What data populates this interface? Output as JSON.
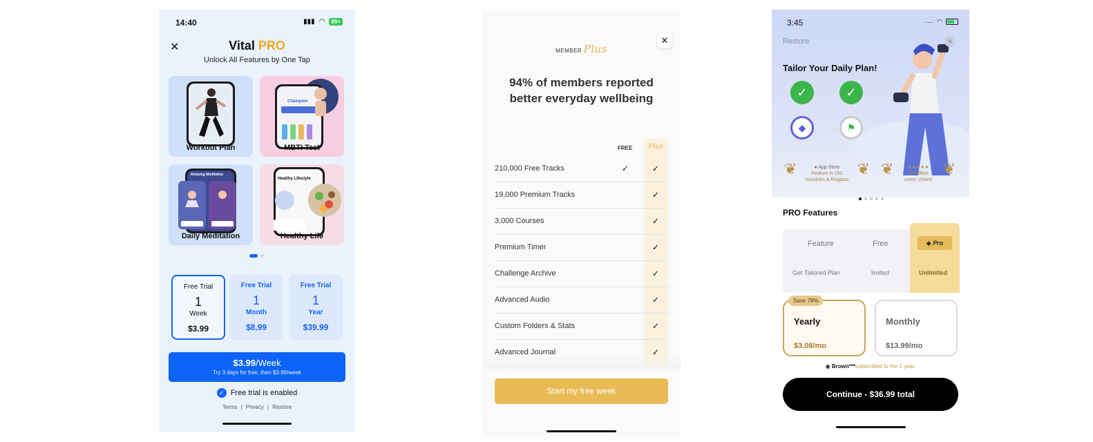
{
  "screen1": {
    "status_time": "14:40",
    "battery": "89+",
    "title_main": "Vital",
    "title_pro": "PRO",
    "subtitle": "Unlock All Features by One Tap",
    "cards": [
      {
        "label": "Workout Plan"
      },
      {
        "label": "MBTI Test"
      },
      {
        "label": "Daily Meditation"
      },
      {
        "label": "Healthy Life"
      }
    ],
    "card_texts": {
      "champion": "Champion",
      "relaxing_meditation": "Relaxing Meditation",
      "healthy_lifestyle": "Healthy Lifestyle"
    },
    "plans": [
      {
        "title": "Free Trial",
        "number": "1",
        "unit": "Week",
        "price": "$3.99",
        "selected": true
      },
      {
        "title": "Free Trial",
        "number": "1",
        "unit": "Month",
        "price": "$8.99",
        "selected": false
      },
      {
        "title": "Free Trial",
        "number": "1",
        "unit": "Year",
        "price": "$39.99",
        "selected": false
      }
    ],
    "cta_price": "$3.99",
    "cta_unit": "/Week",
    "cta_sub": "Try 3 days for free, then $3.99/week",
    "trial_enabled": "Free trial is enabled",
    "links": [
      "Terms",
      "Privacy",
      "Restore"
    ],
    "separator": "|"
  },
  "screen2": {
    "logo_member": "MEMBER",
    "logo_plus": "Plus",
    "headline": "94% of members reported better everyday wellbeing",
    "col_free": "FREE",
    "col_plus": "Plus",
    "check": "✓",
    "features": [
      {
        "name": "210,000 Free Tracks",
        "free": true
      },
      {
        "name": "19,000 Premium Tracks",
        "free": false
      },
      {
        "name": "3,000 Courses",
        "free": false
      },
      {
        "name": "Premium Timer",
        "free": false
      },
      {
        "name": "Challenge Archive",
        "free": false
      },
      {
        "name": "Advanced Audio",
        "free": false
      },
      {
        "name": "Custom Folders & Stats",
        "free": false
      },
      {
        "name": "Advanced Journal",
        "free": false
      }
    ],
    "cta": "Start my free week"
  },
  "screen3": {
    "status_time": "3:45",
    "restore": "Restore",
    "tailor": "Tailor Your Daily Plan!",
    "laurel_left": {
      "top": "App Store",
      "line1": "Feature in 192",
      "line2": "countries & Regious"
    },
    "laurel_right": {
      "top": "★★★★★",
      "line1": "10 Million",
      "line2": "users' choice"
    },
    "pro_features": "PRO Features",
    "table_headers": [
      "Feature",
      "Free",
      "Pro"
    ],
    "table_row": [
      "Get Tailored Plan",
      "limited",
      "Unlimited"
    ],
    "save_badge": "Save 78%",
    "plans": [
      {
        "name": "Yearly",
        "price": "$3.08/mo",
        "selected": true
      },
      {
        "name": "Monthly",
        "price": "$13.99/mo",
        "selected": false
      }
    ],
    "subscriber_name": "Brown***",
    "subscriber_text": "subscribed to the 1 year.",
    "cta": "Continue - $36.99 total"
  },
  "colors": {
    "blue": "#1763f2",
    "gold": "#e9bb55",
    "green": "#3cb54a",
    "black": "#000000"
  }
}
